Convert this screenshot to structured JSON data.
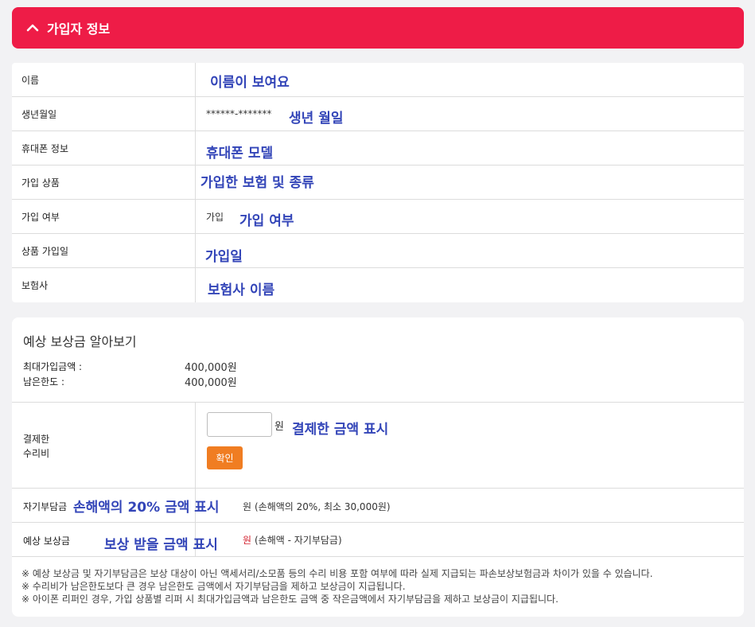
{
  "header": {
    "title": "가입자 정보"
  },
  "info": {
    "rows": [
      {
        "label": "이름",
        "prefix": "",
        "annotation": "이름이 보여요"
      },
      {
        "label": "생년월일",
        "prefix": "******-*******",
        "annotation": "생년 월일"
      },
      {
        "label": "휴대폰 정보",
        "prefix": "",
        "annotation": "휴대폰 모델"
      },
      {
        "label": "가입 상품",
        "prefix": "",
        "annotation": "가입한 보험 및 종류"
      },
      {
        "label": "가입 여부",
        "prefix": "가입",
        "annotation": "가입 여부"
      },
      {
        "label": "상품 가입일",
        "prefix": "",
        "annotation": "가입일"
      },
      {
        "label": "보험사",
        "prefix": "",
        "annotation": "보험사 이름"
      }
    ]
  },
  "estimate": {
    "title": "예상 보상금 알아보기",
    "max_label": "최대가입금액 :",
    "max_value": "400,000원",
    "remain_label": "남은한도 :",
    "remain_value": "400,000원",
    "repair_label_line1": "결제한",
    "repair_label_line2": "수리비",
    "input_value": "",
    "won": "원",
    "repair_annotation": "결제한 금액 표시",
    "confirm_label": "확인",
    "deductible_label": "자기부담금",
    "deductible_annotation": "손해액의 20% 금액 표시",
    "deductible_unit": "원",
    "deductible_note": "(손해액의 20%, 최소 30,000원)",
    "expected_label": "예상 보상금",
    "expected_annotation": "보상 받을 금액 표시",
    "expected_unit": "원",
    "expected_note": "(손해액 - 자기부담금)"
  },
  "notes": [
    "※ 예상 보상금 및 자기부담금은 보상 대상이 아닌 액세서리/소모품 등의 수리 비용 포함 여부에 따라 실제 지급되는 파손보상보험금과 차이가 있을 수 있습니다.",
    "※ 수리비가 남은한도보다 큰 경우 남은한도 금액에서 자기부담금을 제하고 보상금이 지급됩니다.",
    "※ 아이폰 리퍼인 경우, 가입 상품별 리퍼 시 최대가입금액과 남은한도 금액 중 작은금액에서 자기부담금을 제하고 보상금이 지급됩니다."
  ],
  "colors": {
    "header": "#ee1c47",
    "annotation": "#3345b8",
    "button": "#f07d22"
  }
}
